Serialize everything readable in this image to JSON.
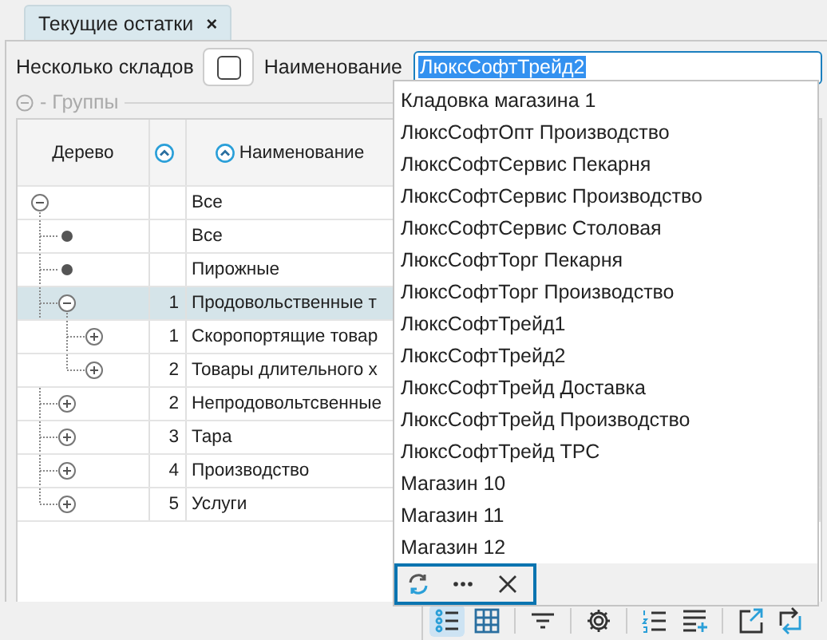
{
  "tabs": [
    {
      "label": "Текущие остатки",
      "close": "×",
      "selected": true
    }
  ],
  "filters": {
    "multi_warehouse_label": "Несколько складов",
    "multi_warehouse_checked": false,
    "name_label": "Наименование",
    "name_value": "ЛюксСофтТрейд2",
    "name_text_selected": true
  },
  "groups_panel": {
    "label": "- Группы",
    "expanded": true
  },
  "table": {
    "columns": [
      "Дерево",
      "",
      "Наименование"
    ],
    "rows": [
      {
        "name": "Все",
        "expanded": true,
        "selected": false,
        "children": [
          {
            "name": "Все",
            "selected": false
          },
          {
            "name": "Пирожные",
            "selected": false
          },
          {
            "name": "Продовольственные т",
            "code": "1",
            "expanded": true,
            "selected": true,
            "children": [
              {
                "name": "Скоропортящие товар",
                "code": "1",
                "expanded": false,
                "selected": false
              },
              {
                "name": "Товары длительного х",
                "code": "2",
                "expanded": false,
                "selected": false
              }
            ]
          },
          {
            "name": "Непродовольтсвенные",
            "code": "2",
            "expanded": false,
            "selected": false
          },
          {
            "name": "Тара",
            "code": "3",
            "expanded": false,
            "selected": false
          },
          {
            "name": "Производство",
            "code": "4",
            "expanded": false,
            "selected": false
          },
          {
            "name": "Услуги",
            "code": "5",
            "expanded": false,
            "selected": false
          }
        ]
      }
    ]
  },
  "dropdown": {
    "items": [
      "Кладовка магазина 1",
      "ЛюксСофтОпт Производство",
      "ЛюксСофтСервис Пекарня",
      "ЛюксСофтСервис Производство",
      "ЛюксСофтСервис Столовая",
      "ЛюксСофтТорг Пекарня",
      "ЛюксСофтТорг Производство",
      "ЛюксСофтТрейд1",
      "ЛюксСофтТрейд2",
      "ЛюксСофтТрейд Доставка",
      "ЛюксСофтТрейд Производство",
      "ЛюксСофтТрейд ТРС",
      "Магазин 10",
      "Магазин 11",
      "Магазин 12"
    ],
    "footer": [
      {
        "kind": "refresh"
      },
      {
        "kind": "more"
      },
      {
        "kind": "close"
      }
    ]
  },
  "toolbar": [
    {
      "kind": "list",
      "selected": true
    },
    {
      "kind": "grid",
      "selected": false
    },
    {
      "kind": "separator"
    },
    {
      "kind": "filter",
      "selected": false
    },
    {
      "kind": "separator"
    },
    {
      "kind": "settings",
      "selected": false
    },
    {
      "kind": "separator"
    },
    {
      "kind": "numbered-list",
      "selected": false
    },
    {
      "kind": "add-row",
      "selected": false
    },
    {
      "kind": "separator"
    },
    {
      "kind": "export",
      "selected": false
    },
    {
      "kind": "swap",
      "selected": false
    }
  ]
}
